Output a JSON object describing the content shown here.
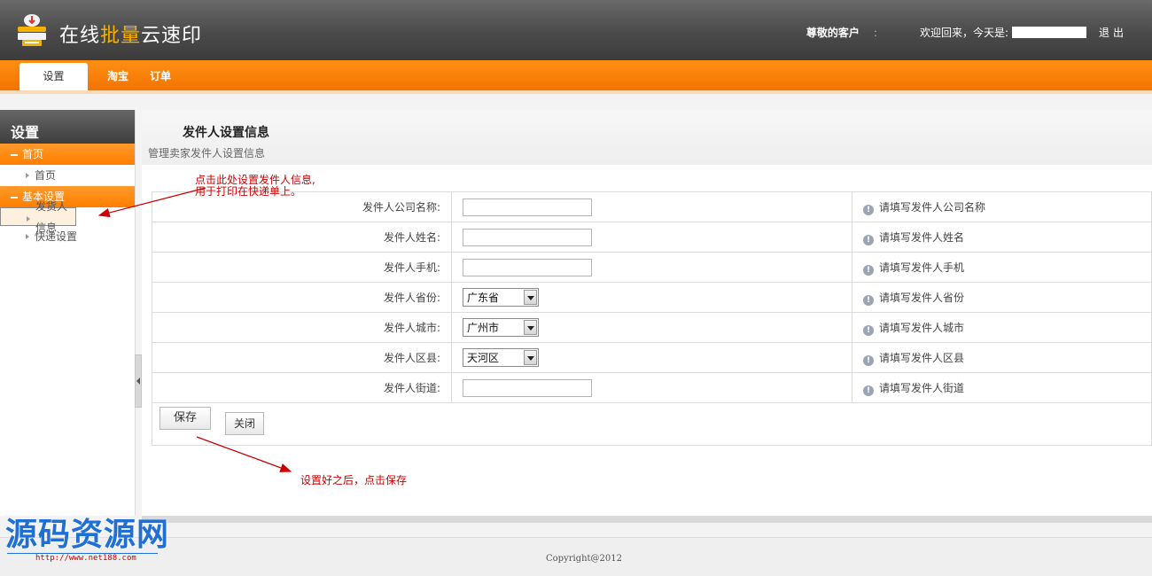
{
  "header": {
    "logo_text_a": "在线",
    "logo_text_b": "批量",
    "logo_text_c": "云速印",
    "greeting": "尊敬的客户",
    "separator": ":",
    "welcome": "欢迎回来，今天是:",
    "logout": "退出"
  },
  "nav": {
    "tabs": [
      {
        "label": "设置"
      },
      {
        "label": "淘宝"
      },
      {
        "label": "订单"
      }
    ]
  },
  "sidebar": {
    "title": "设置",
    "group1": "首页",
    "group1_items": [
      "首页"
    ],
    "group2": "基本设置",
    "group2_items": [
      "发货人信息",
      "快递设置"
    ]
  },
  "main": {
    "title": "发件人设置信息",
    "subtitle": "管理卖家发件人设置信息",
    "rows": [
      {
        "label": "发件人公司名称:",
        "type": "text",
        "value": "",
        "tip": "请填写发件人公司名称"
      },
      {
        "label": "发件人姓名:",
        "type": "text",
        "value": "",
        "tip": "请填写发件人姓名"
      },
      {
        "label": "发件人手机:",
        "type": "text",
        "value": "",
        "tip": "请填写发件人手机"
      },
      {
        "label": "发件人省份:",
        "type": "select",
        "value": "广东省",
        "tip": "请填写发件人省份"
      },
      {
        "label": "发件人城市:",
        "type": "select",
        "value": "广州市",
        "tip": "请填写发件人城市"
      },
      {
        "label": "发件人区县:",
        "type": "select",
        "value": "天河区",
        "tip": "请填写发件人区县"
      },
      {
        "label": "发件人街道:",
        "type": "text",
        "value": "",
        "tip": "请填写发件人街道"
      }
    ],
    "save_label": "保存",
    "close_label": "关闭"
  },
  "annotations": {
    "note1_line1": "点击此处设置发件人信息,",
    "note1_line2": "用于打印在快递单上。",
    "note2": "设置好之后，点击保存"
  },
  "footer": {
    "copyright": "Copyright@2012"
  },
  "watermark": {
    "title": "源码资源网",
    "url": "http://www.net188.com"
  },
  "colors": {
    "accent_orange": "#f27400",
    "header_dark": "#4a4a4a",
    "annotation_red": "#cc0000",
    "watermark_blue": "#1e6fd6"
  }
}
